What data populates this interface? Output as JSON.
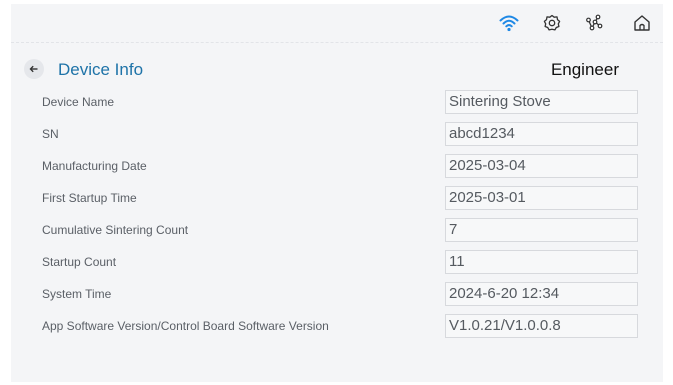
{
  "status_bar": {
    "icons": [
      "wifi-icon",
      "settings-icon",
      "network-icon",
      "home-icon"
    ],
    "wifi_color": "#1e88e5"
  },
  "header": {
    "back_icon": "arrow-left-icon",
    "title": "Device Info",
    "role": "Engineer"
  },
  "fields": [
    {
      "label": "Device Name",
      "value": "Sintering Stove"
    },
    {
      "label": "SN",
      "value": "abcd1234"
    },
    {
      "label": "Manufacturing Date",
      "value": "2025-03-04"
    },
    {
      "label": "First Startup Time",
      "value": "2025-03-01"
    },
    {
      "label": "Cumulative Sintering Count",
      "value": "7"
    },
    {
      "label": "Startup Count",
      "value": "11"
    },
    {
      "label": "System Time",
      "value": "2024-6-20 12:34"
    },
    {
      "label": "App Software Version/Control Board Software Version",
      "value": "V1.0.21/V1.0.0.8"
    }
  ],
  "colors": {
    "accent": "#1e73a8",
    "background": "#f4f5f7",
    "field_border": "#d7d9dd"
  }
}
